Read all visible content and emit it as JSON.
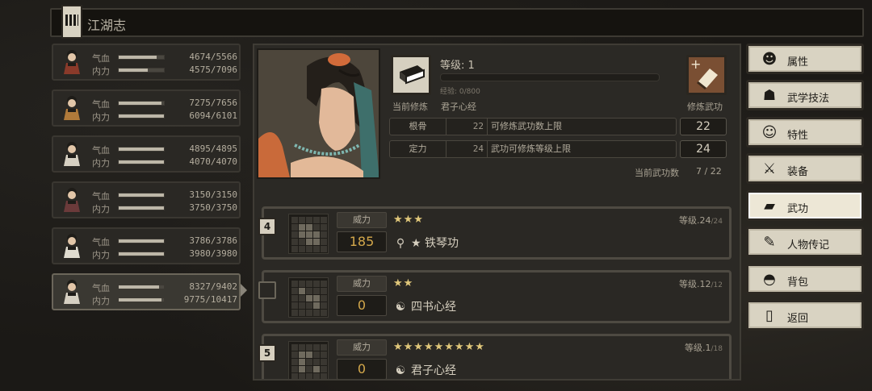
{
  "title": "江湖志",
  "characters": [
    {
      "hp_label": "气血",
      "hp": "4674/5566",
      "hp_frac": 0.84,
      "mp_label": "内力",
      "mp": "4575/7096",
      "mp_frac": 0.64
    },
    {
      "hp_label": "气血",
      "hp": "7275/7656",
      "hp_frac": 0.95,
      "mp_label": "内力",
      "mp": "6094/6101",
      "mp_frac": 1.0
    },
    {
      "hp_label": "气血",
      "hp": "4895/4895",
      "hp_frac": 1.0,
      "mp_label": "内力",
      "mp": "4070/4070",
      "mp_frac": 1.0
    },
    {
      "hp_label": "气血",
      "hp": "3150/3150",
      "hp_frac": 1.0,
      "mp_label": "内力",
      "mp": "3750/3750",
      "mp_frac": 1.0
    },
    {
      "hp_label": "气血",
      "hp": "3786/3786",
      "hp_frac": 1.0,
      "mp_label": "内力",
      "mp": "3980/3980",
      "mp_frac": 1.0
    },
    {
      "hp_label": "气血",
      "hp": "8327/9402",
      "hp_frac": 0.89,
      "mp_label": "内力",
      "mp": "9775/10417",
      "mp_frac": 0.94
    }
  ],
  "detail": {
    "level_label": "等级",
    "level": "1",
    "exp_text": "经验: 0/800",
    "current_label": "当前修炼",
    "current_skill": "君子心经",
    "learn_label": "修炼武功",
    "attr1_name": "根骨",
    "attr1_value": "22",
    "attr1_desc": "可修炼武功数上限",
    "attr1_box": "22",
    "attr2_name": "定力",
    "attr2_value": "24",
    "attr2_desc": "武功可修炼等级上限",
    "attr2_box": "24",
    "skill_count_label": "当前武功数",
    "skill_count": "7 / 22"
  },
  "skills": [
    {
      "slot": "4",
      "power_label": "威力",
      "power": "185",
      "stars": "★★★",
      "level_label": "等级",
      "level": ".24",
      "level_max": "/24",
      "type_icon": "flute",
      "name": "★ 铁琴功"
    },
    {
      "slot": "",
      "power_label": "威力",
      "power": "0",
      "stars": "★★",
      "level_label": "等级",
      "level": ".12",
      "level_max": "/12",
      "type_icon": "yin-yang",
      "name": "四书心经"
    },
    {
      "slot": "5",
      "power_label": "威力",
      "power": "0",
      "stars": "★★★★★★★★★",
      "level_label": "等级",
      "level": ".1",
      "level_max": "/18",
      "type_icon": "yin-yang",
      "name": "君子心经"
    }
  ],
  "menu": [
    {
      "label": "属性",
      "icon": "person-icon"
    },
    {
      "label": "武学技法",
      "icon": "fighter-icon"
    },
    {
      "label": "特性",
      "icon": "trait-icon"
    },
    {
      "label": "装备",
      "icon": "sword-icon"
    },
    {
      "label": "武功",
      "icon": "book-icon"
    },
    {
      "label": "人物传记",
      "icon": "biography-icon"
    },
    {
      "label": "背包",
      "icon": "bag-icon"
    },
    {
      "label": "返回",
      "icon": "exit-door-icon"
    }
  ],
  "colors": {
    "accent_gold": "#d4a84b",
    "panel": "#2a2824",
    "menu_bg": "#d9d3c2"
  }
}
